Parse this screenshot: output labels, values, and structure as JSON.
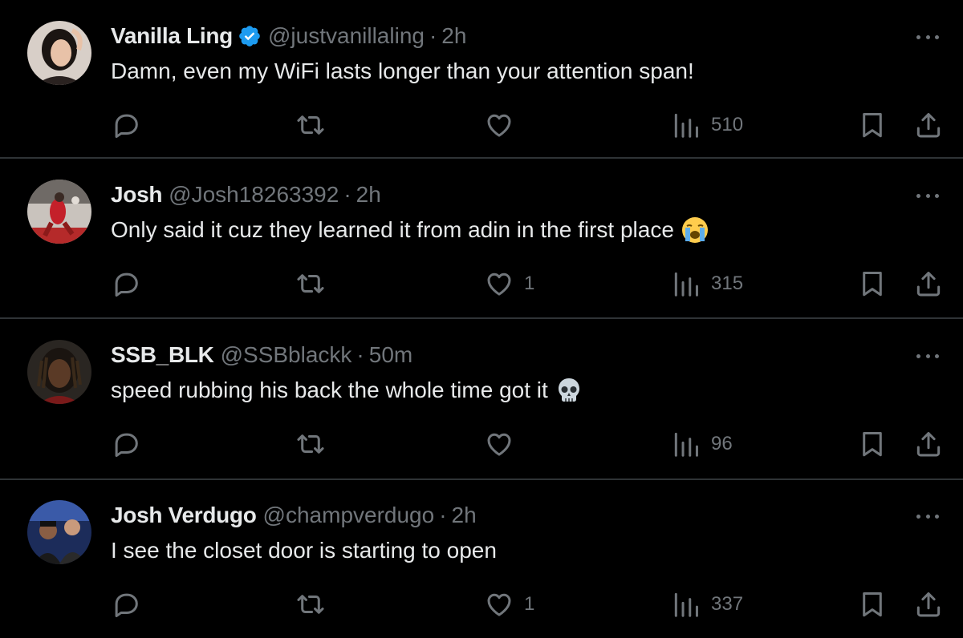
{
  "colors": {
    "background": "#000000",
    "text_primary": "#e7e9ea",
    "text_secondary": "#71767b",
    "divider": "#2f3336",
    "verified_blue": "#1d9bf0"
  },
  "tweets": [
    {
      "display_name": "Vanilla Ling",
      "verified": true,
      "handle": "@justvanillaling",
      "separator": "·",
      "time": "2h",
      "text": "Damn, even my WiFi lasts longer than your attention span!",
      "emoji": "",
      "like_count": "",
      "view_count": "510",
      "avatar_icon": "avatar-woman"
    },
    {
      "display_name": "Josh",
      "verified": false,
      "handle": "@Josh18263392",
      "separator": "·",
      "time": "2h",
      "text": "Only said it cuz they learned it from adin in the first place",
      "emoji": "loudly-crying-face-icon",
      "like_count": "1",
      "view_count": "315",
      "avatar_icon": "avatar-basketball"
    },
    {
      "display_name": "SSB_BLK",
      "verified": false,
      "handle": "@SSBblackk",
      "separator": "·",
      "time": "50m",
      "text": "speed rubbing his back the whole time got it",
      "emoji": "skull-icon",
      "like_count": "",
      "view_count": "96",
      "avatar_icon": "avatar-man-dreads"
    },
    {
      "display_name": "Josh Verdugo",
      "verified": false,
      "handle": "@champverdugo",
      "separator": "·",
      "time": "2h",
      "text": "I see the closet door is starting to open",
      "emoji": "",
      "like_count": "1",
      "view_count": "337",
      "avatar_icon": "avatar-two-men"
    }
  ]
}
